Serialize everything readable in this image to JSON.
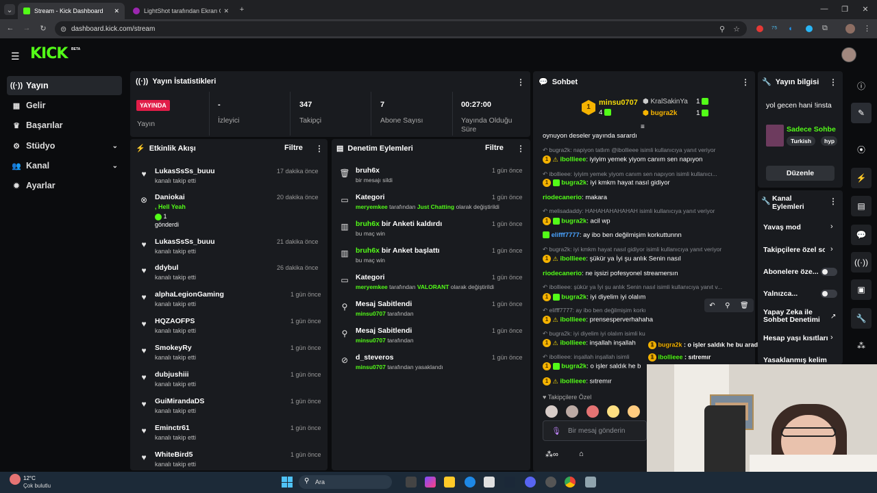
{
  "browser": {
    "tabs": [
      {
        "title": "Stream - Kick Dashboard"
      },
      {
        "title": "LightShot tarafından Ekran Gör"
      }
    ],
    "url": "dashboard.kick.com/stream"
  },
  "header": {
    "logo": "KICK",
    "beta": "BETA"
  },
  "sidebar": {
    "items": [
      {
        "label": "Yayın",
        "icon": "broadcast-icon"
      },
      {
        "label": "Gelir",
        "icon": "revenue-icon"
      },
      {
        "label": "Başarılar",
        "icon": "trophy-icon"
      },
      {
        "label": "Stüdyo",
        "icon": "gear-icon"
      },
      {
        "label": "Kanal",
        "icon": "users-icon"
      },
      {
        "label": "Ayarlar",
        "icon": "settings-icon"
      }
    ]
  },
  "stats": {
    "title": "Yayın İstatistikleri",
    "live": "YAYINDA",
    "live_label": "Yayın",
    "items": [
      {
        "value": "-",
        "label": "İzleyici"
      },
      {
        "value": "347",
        "label": "Takipçi"
      },
      {
        "value": "7",
        "label": "Abone Sayısı"
      },
      {
        "value": "00:27:00",
        "label": "Yayında Olduğu Süre"
      }
    ]
  },
  "activity": {
    "title": "Etkinlik Akışı",
    "filter": "Filtre",
    "rows": [
      {
        "name": "LukasSsSs_buuu",
        "sub": "kanalı takip etti",
        "time": "17 dakika önce"
      },
      {
        "name": "Daniokai",
        "sub": ", Hell Yeah",
        "gift": "1",
        "sub2": "gönderdi",
        "time": "20 dakika önce"
      },
      {
        "name": "LukasSsSs_buuu",
        "sub": "kanalı takip etti",
        "time": "21 dakika önce"
      },
      {
        "name": "ddybul",
        "sub": "kanalı takip etti",
        "time": "26 dakika önce"
      },
      {
        "name": "alphaLegionGaming",
        "sub": "kanalı takip etti",
        "time": "1 gün önce"
      },
      {
        "name": "HQZAOFPS",
        "sub": "kanalı takip etti",
        "time": "1 gün önce"
      },
      {
        "name": "SmokeyRy",
        "sub": "kanalı takip etti",
        "time": "1 gün önce"
      },
      {
        "name": "dubjushiii",
        "sub": "kanalı takip etti",
        "time": "1 gün önce"
      },
      {
        "name": "GuiMirandaDS",
        "sub": "kanalı takip etti",
        "time": "1 gün önce"
      },
      {
        "name": "Eminctr61",
        "sub": "kanalı takip etti",
        "time": "1 gün önce"
      },
      {
        "name": "WhiteBird5",
        "sub": "kanalı takip etti",
        "time": "1 gün önce"
      }
    ]
  },
  "moderation": {
    "title": "Denetim Eylemleri",
    "filter": "Filtre",
    "rows": [
      {
        "title": "bruh6x",
        "sub": "bir mesajı sildi",
        "time": "1 gün önce"
      },
      {
        "title": "Kategori",
        "u": "meryemkee",
        "mid": " tarafından ",
        "cat": "Just Chatting",
        "end": " olarak değiştirildi",
        "time": "1 gün önce"
      },
      {
        "u": "bruh6x",
        "title": " bir Anketi kaldırdı",
        "sub": "bu maç win",
        "time": "1 gün önce"
      },
      {
        "u": "bruh6x",
        "title": " bir Anket başlattı",
        "sub": "bu maç win",
        "time": "1 gün önce"
      },
      {
        "title": "Kategori",
        "u": "meryemkee",
        "mid": " tarafından ",
        "cat": "VALORANT",
        "end": " olarak değiştirildi",
        "time": "1 gün önce"
      },
      {
        "title": "Mesaj Sabitlendi",
        "u": "minsu0707",
        "end": " tarafından",
        "time": "1 gün önce"
      },
      {
        "title": "Mesaj Sabitlendi",
        "u": "minsu0707",
        "end": " tarafından",
        "time": "1 gün önce"
      },
      {
        "title": "d_steveros",
        "u": "minsu0707",
        "end": " tarafından yasaklandı",
        "time": "1 gün önce"
      }
    ]
  },
  "chat": {
    "title": "Sohbet",
    "top": [
      {
        "rank": "1",
        "name": "minsu0707",
        "count": "4"
      },
      {
        "name": "KralSakinYa",
        "count": "1"
      },
      {
        "name": "bugra2k",
        "count": "1"
      }
    ],
    "first_line": "oynuyon deseler yayında sarardı",
    "lines": [
      {
        "reply": "bugra2k: napiyon tatlım @ibollieee isimli kullanıcıya yanıt veriyor",
        "user": "ibollieee",
        "msg": "iyiyim yemek yiyom canım sen napıyon",
        "ucolor": "#f5d90a"
      },
      {
        "reply": "ibollieee: iyiyim yemek yiyom canım sen napıyon isimli kullanıcı...",
        "user": "bugra2k",
        "msg": "iyi kmkm hayat nasıl gidiyor",
        "ucolor": "#f5d90a"
      },
      {
        "user": "riodecanerio",
        "msg": "makara",
        "ucolor": "#53fc18"
      },
      {
        "reply": "melisadaddy: HAHAHAHAHAHAH isimli kullanıcıya yanıt veriyor",
        "user": "bugra2k",
        "msg": "acil wp",
        "ucolor": "#f5d90a"
      },
      {
        "user": "elifff7777",
        "msg": "ay ibo ben değilmişim korkuttunnn",
        "ucolor": "#4aa3ff"
      },
      {
        "reply": "bugra2k: iyi kmkm hayat nasıl gidiyor isimli kullanıcıya yanıt veriyor",
        "user": "ibollieee",
        "msg": "şükür ya İyi şu anlık Senin nasıl",
        "ucolor": "#f5d90a"
      },
      {
        "user": "riodecanerio",
        "msg": "ne işsizi pofesyonel streamersın",
        "ucolor": "#53fc18"
      },
      {
        "reply": "ibollieee: şükür ya İyi şu anlık Senin nasıl isimli kullanıcıya yanıt v...",
        "user": "bugra2k",
        "msg": "iyi diyelim iyi olalım",
        "ucolor": "#f5d90a"
      },
      {
        "reply": "elifff7777: ay ibo ben değilmişim korkuttunnn isimli ku",
        "user": "ibollieee",
        "msg": "prensesperverhahaha",
        "ucolor": "#f5d90a"
      },
      {
        "reply": "bugra2k: iyi diyelim iyi olalım isimli kullanıcıya yanıt veriyor",
        "user": "ibollieee",
        "msg": "inşallah inşallah",
        "ucolor": "#f5d90a"
      },
      {
        "reply": "ibollieee: inşallah inşallah isimli",
        "user": "bugra2k",
        "msg": "o işler saldık he b",
        "ucolor": "#f5d90a"
      },
      {
        "user": "ibollieee",
        "msg": "sıtremır",
        "ucolor": "#f5d90a"
      }
    ],
    "overlay1_user": "bugra2k",
    "overlay1_msg": "o işler saldık he bu arada kankim",
    "overlay2_user": "ibollieee",
    "overlay2_msg": "sıtremır",
    "followers_only": "Takipçilere Özel",
    "input_placeholder": "Bir mesaj gönderin"
  },
  "stream_info": {
    "title": "Yayın bilgisi",
    "stream_title": "yol gecen hani !insta",
    "category": "Sadece Sohbe",
    "tags": [
      "Turkish",
      "hyp"
    ],
    "edit": "Düzenle"
  },
  "channel_actions": {
    "title": "Kanal Eylemleri",
    "items": [
      {
        "label": "Yavaş mod",
        "kind": "chevron"
      },
      {
        "label": "Takipçilere özel so",
        "kind": "chevron"
      },
      {
        "label": "Abonelere öze...",
        "kind": "toggle"
      },
      {
        "label": "Yalnızca...",
        "kind": "toggle"
      },
      {
        "label": "Yapay Zeka ile Sohbet Denetimi",
        "kind": "external"
      },
      {
        "label": "Hesap yaşı kısıtları",
        "kind": "chevron"
      },
      {
        "label": "Yasaklanmış kelim",
        "kind": "chevron"
      }
    ]
  },
  "taskbar": {
    "temp": "12°C",
    "weather": "Çok bulutlu",
    "search": "Ara"
  },
  "colors": {
    "accent": "#53fc18",
    "live": "#e11d48",
    "panel": "#191b1f",
    "bg": "#0b0c0e"
  }
}
